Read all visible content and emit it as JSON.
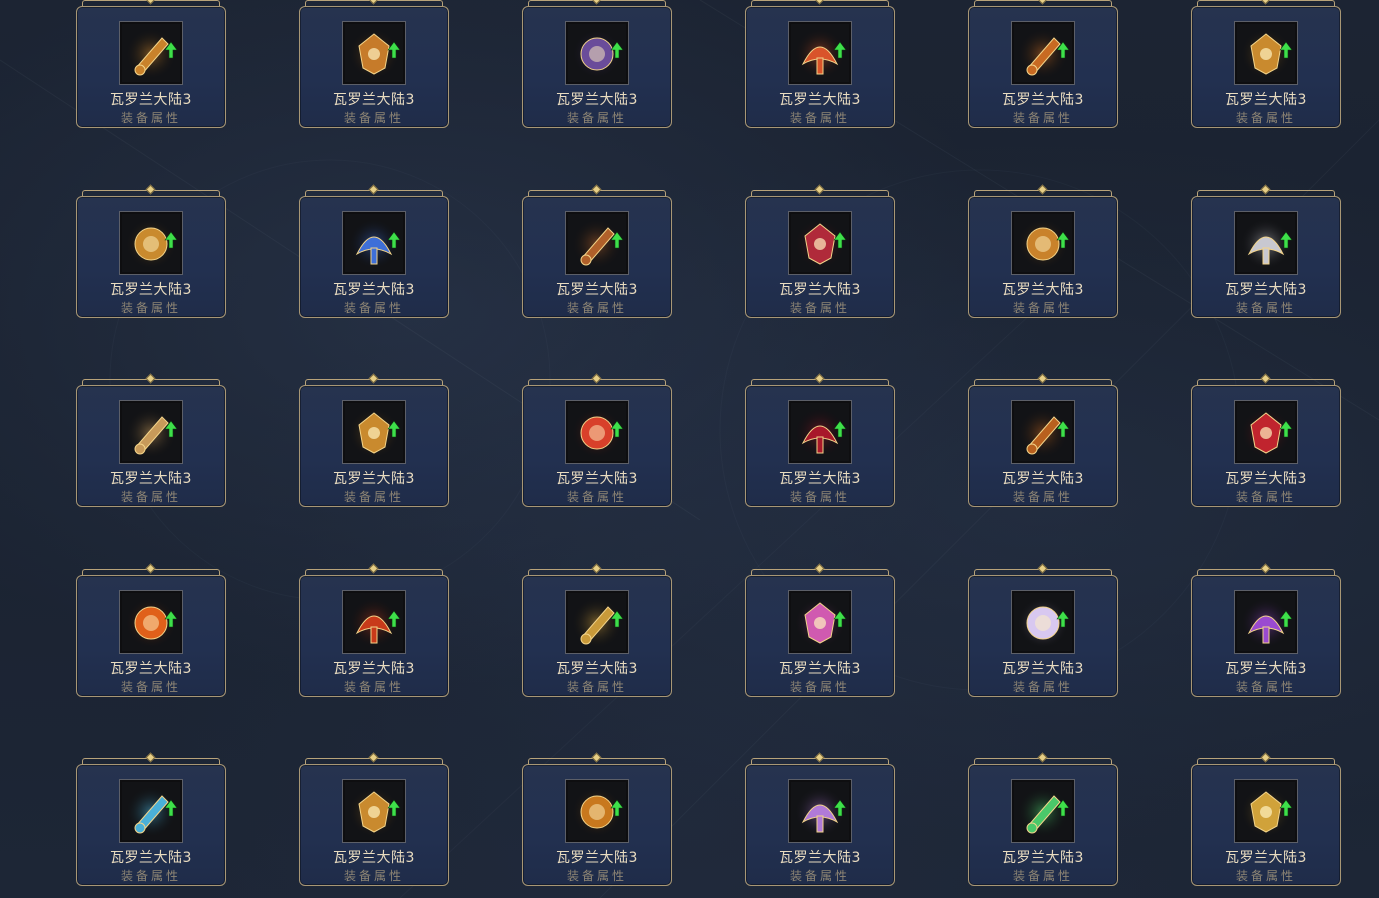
{
  "cards": [
    {
      "name": "瓦罗兰大陆3",
      "sub": "装备属性",
      "icon": "golden-sword-icon",
      "color": "#c9822b"
    },
    {
      "name": "瓦罗兰大陆3",
      "sub": "装备属性",
      "icon": "golden-armor-icon",
      "color": "#c67b2a"
    },
    {
      "name": "瓦罗兰大陆3",
      "sub": "装备属性",
      "icon": "dark-mage-icon",
      "color": "#6a4c9a"
    },
    {
      "name": "瓦罗兰大陆3",
      "sub": "装备属性",
      "icon": "flame-crown-icon",
      "color": "#d9542a"
    },
    {
      "name": "瓦罗兰大陆3",
      "sub": "装备属性",
      "icon": "fire-blade-icon",
      "color": "#c86a22"
    },
    {
      "name": "瓦罗兰大陆3",
      "sub": "装备属性",
      "icon": "golden-wings-icon",
      "color": "#c98a2e"
    },
    {
      "name": "瓦罗兰大陆3",
      "sub": "装备属性",
      "icon": "golden-gauntlet-icon",
      "color": "#c98a2e"
    },
    {
      "name": "瓦罗兰大陆3",
      "sub": "装备属性",
      "icon": "blue-orb-icon",
      "color": "#3e6fd8"
    },
    {
      "name": "瓦罗兰大陆3",
      "sub": "装备属性",
      "icon": "bronze-helm-icon",
      "color": "#b0602a"
    },
    {
      "name": "瓦罗兰大陆3",
      "sub": "装备属性",
      "icon": "crimson-bow-icon",
      "color": "#b02a3a"
    },
    {
      "name": "瓦罗兰大陆3",
      "sub": "装备属性",
      "icon": "golden-blade-icon",
      "color": "#c9822b"
    },
    {
      "name": "瓦罗兰大陆3",
      "sub": "装备属性",
      "icon": "silver-gauntlet-icon",
      "color": "#c8c8d0"
    },
    {
      "name": "瓦罗兰大陆3",
      "sub": "装备属性",
      "icon": "bone-blade-icon",
      "color": "#c79a5a"
    },
    {
      "name": "瓦罗兰大陆3",
      "sub": "装备属性",
      "icon": "amber-wings-icon",
      "color": "#c98a2e"
    },
    {
      "name": "瓦罗兰大陆3",
      "sub": "装备属性",
      "icon": "fire-sigil-icon",
      "color": "#d8402a"
    },
    {
      "name": "瓦罗兰大陆3",
      "sub": "装备属性",
      "icon": "red-dragon-icon",
      "color": "#a8182a"
    },
    {
      "name": "瓦罗兰大陆3",
      "sub": "装备属性",
      "icon": "copper-cuirass-icon",
      "color": "#b8601e"
    },
    {
      "name": "瓦罗兰大陆3",
      "sub": "装备属性",
      "icon": "ruby-wings-icon",
      "color": "#c0242e"
    },
    {
      "name": "瓦罗兰大陆3",
      "sub": "装备属性",
      "icon": "fire-gem-icon",
      "color": "#e0601a"
    },
    {
      "name": "瓦罗兰大陆3",
      "sub": "装备属性",
      "icon": "fire-shield-icon",
      "color": "#c83a1a"
    },
    {
      "name": "瓦罗兰大陆3",
      "sub": "装备属性",
      "icon": "golden-banner-icon",
      "color": "#c99a3a"
    },
    {
      "name": "瓦罗兰大陆3",
      "sub": "装备属性",
      "icon": "jeweled-amulet-icon",
      "color": "#d05ab0"
    },
    {
      "name": "瓦罗兰大陆3",
      "sub": "装备属性",
      "icon": "crystal-crown-icon",
      "color": "#d8c8f0"
    },
    {
      "name": "瓦罗兰大陆3",
      "sub": "装备属性",
      "icon": "amethyst-scepter-icon",
      "color": "#9a4ad0"
    },
    {
      "name": "瓦罗兰大陆3",
      "sub": "装备属性",
      "icon": "frost-skull-icon",
      "color": "#4ab0d8"
    },
    {
      "name": "瓦罗兰大陆3",
      "sub": "装备属性",
      "icon": "crowned-chest-icon",
      "color": "#c98a2e"
    },
    {
      "name": "瓦罗兰大陆3",
      "sub": "装备属性",
      "icon": "web-sigil-icon",
      "color": "#c8781e"
    },
    {
      "name": "瓦罗兰大陆3",
      "sub": "装备属性",
      "icon": "violet-orb-icon",
      "color": "#b07ad8"
    },
    {
      "name": "瓦罗兰大陆3",
      "sub": "装备属性",
      "icon": "jade-staff-icon",
      "color": "#4ac86a"
    },
    {
      "name": "瓦罗兰大陆3",
      "sub": "装备属性",
      "icon": "golden-horn-icon",
      "color": "#d0a23a"
    }
  ],
  "upgrade_arrow_color": "#3ee04a",
  "frame_color": "#a89775",
  "card_color": "#223050"
}
